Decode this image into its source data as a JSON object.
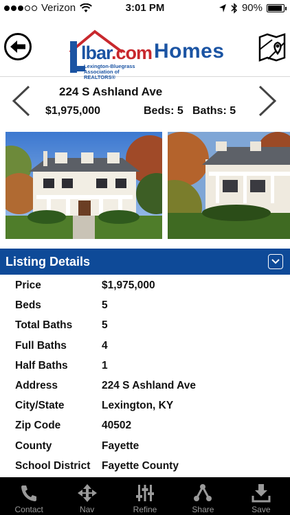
{
  "status_bar": {
    "carrier": "Verizon",
    "time": "3:01 PM",
    "battery": "90%",
    "battery_level": 0.9
  },
  "header": {
    "logo_text_main": "lbar",
    "logo_text_suffix": ".com",
    "logo_subtitle_line1": "Lexington-Bluegrass",
    "logo_subtitle_line2": "Association of REALTORS®",
    "title": "Homes",
    "back_icon": "back-arrow-icon",
    "map_icon": "map-pin-icon"
  },
  "property": {
    "address": "224 S Ashland Ave",
    "price": "$1,975,000",
    "beds": "Beds: 5",
    "baths": "Baths: 5"
  },
  "listing_details": {
    "title": "Listing Details",
    "rows": [
      {
        "label": "Price",
        "value": "$1,975,000"
      },
      {
        "label": "Beds",
        "value": "5"
      },
      {
        "label": "Total Baths",
        "value": "5"
      },
      {
        "label": "Full Baths",
        "value": "4"
      },
      {
        "label": "Half Baths",
        "value": "1"
      },
      {
        "label": "Address",
        "value": "224 S Ashland Ave"
      },
      {
        "label": "City/State",
        "value": "Lexington, KY"
      },
      {
        "label": "Zip Code",
        "value": "40502"
      },
      {
        "label": "County",
        "value": "Fayette"
      },
      {
        "label": "School District",
        "value": "Fayette County"
      }
    ]
  },
  "tabbar": {
    "items": [
      {
        "label": "Contact",
        "icon": "phone-icon"
      },
      {
        "label": "Nav",
        "icon": "navigation-icon"
      },
      {
        "label": "Refine",
        "icon": "sliders-icon"
      },
      {
        "label": "Share",
        "icon": "share-icon"
      },
      {
        "label": "Save",
        "icon": "download-icon"
      }
    ]
  },
  "colors": {
    "brand_blue": "#0e4a98",
    "logo_blue": "#1b54a3",
    "logo_red": "#c8282d",
    "tabbar_bg": "#000000",
    "tab_label": "#9a9a9a"
  }
}
